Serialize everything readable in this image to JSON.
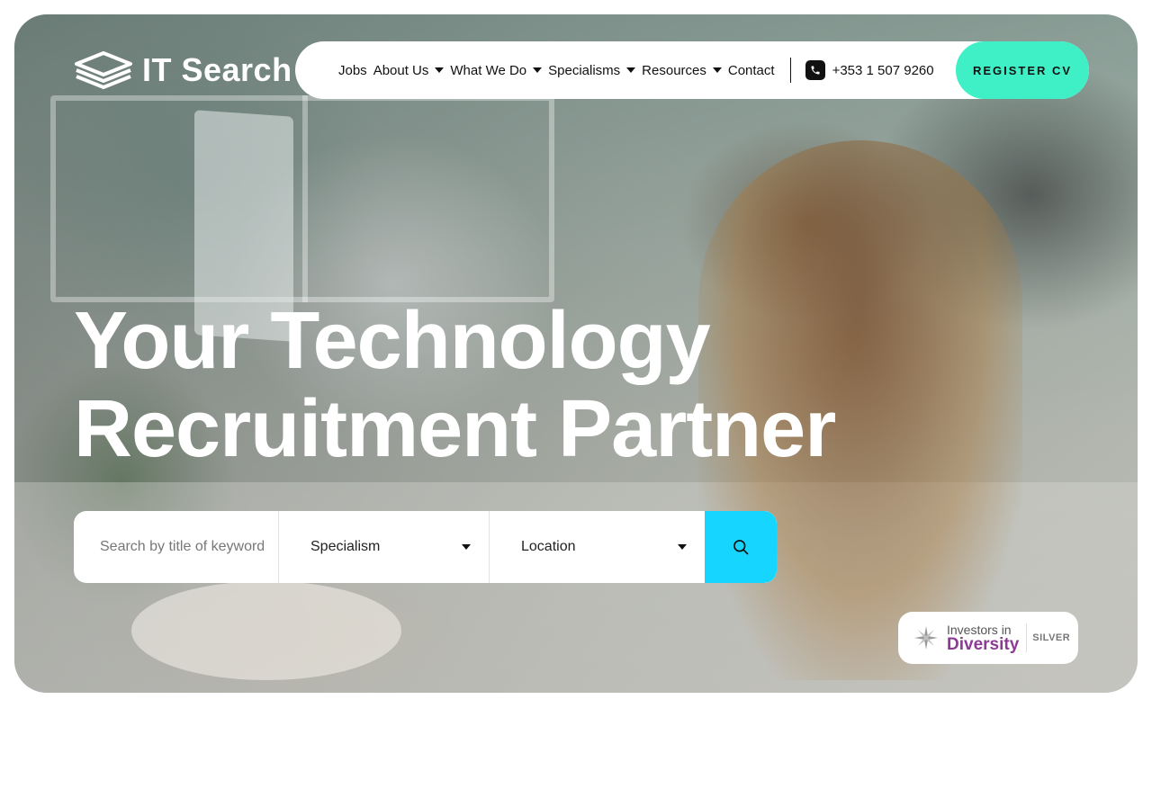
{
  "brand": {
    "name": "IT Search"
  },
  "nav": {
    "items": [
      {
        "label": "Jobs",
        "has_dropdown": false
      },
      {
        "label": "About Us",
        "has_dropdown": true
      },
      {
        "label": "What We Do",
        "has_dropdown": true
      },
      {
        "label": "Specialisms",
        "has_dropdown": true
      },
      {
        "label": "Resources",
        "has_dropdown": true
      },
      {
        "label": "Contact",
        "has_dropdown": false
      }
    ],
    "phone": "+353 1 507 9260",
    "cta": "REGISTER CV"
  },
  "hero": {
    "headline_line1": "Your Technology",
    "headline_line2": "Recruitment Partner"
  },
  "search": {
    "placeholder": "Search by title of keyword",
    "value": "",
    "specialism": "Specialism",
    "location": "Location"
  },
  "badge": {
    "line1": "Investors in",
    "line2": "Diversity",
    "tier": "SILVER"
  },
  "colors": {
    "accent_mint": "#3ff0c6",
    "accent_cyan": "#16d6ff",
    "diversity_purple": "#8b3b93"
  },
  "icons": [
    "logo-mark-icon",
    "caret-down-icon",
    "phone-icon",
    "search-icon",
    "diversity-star-icon"
  ]
}
